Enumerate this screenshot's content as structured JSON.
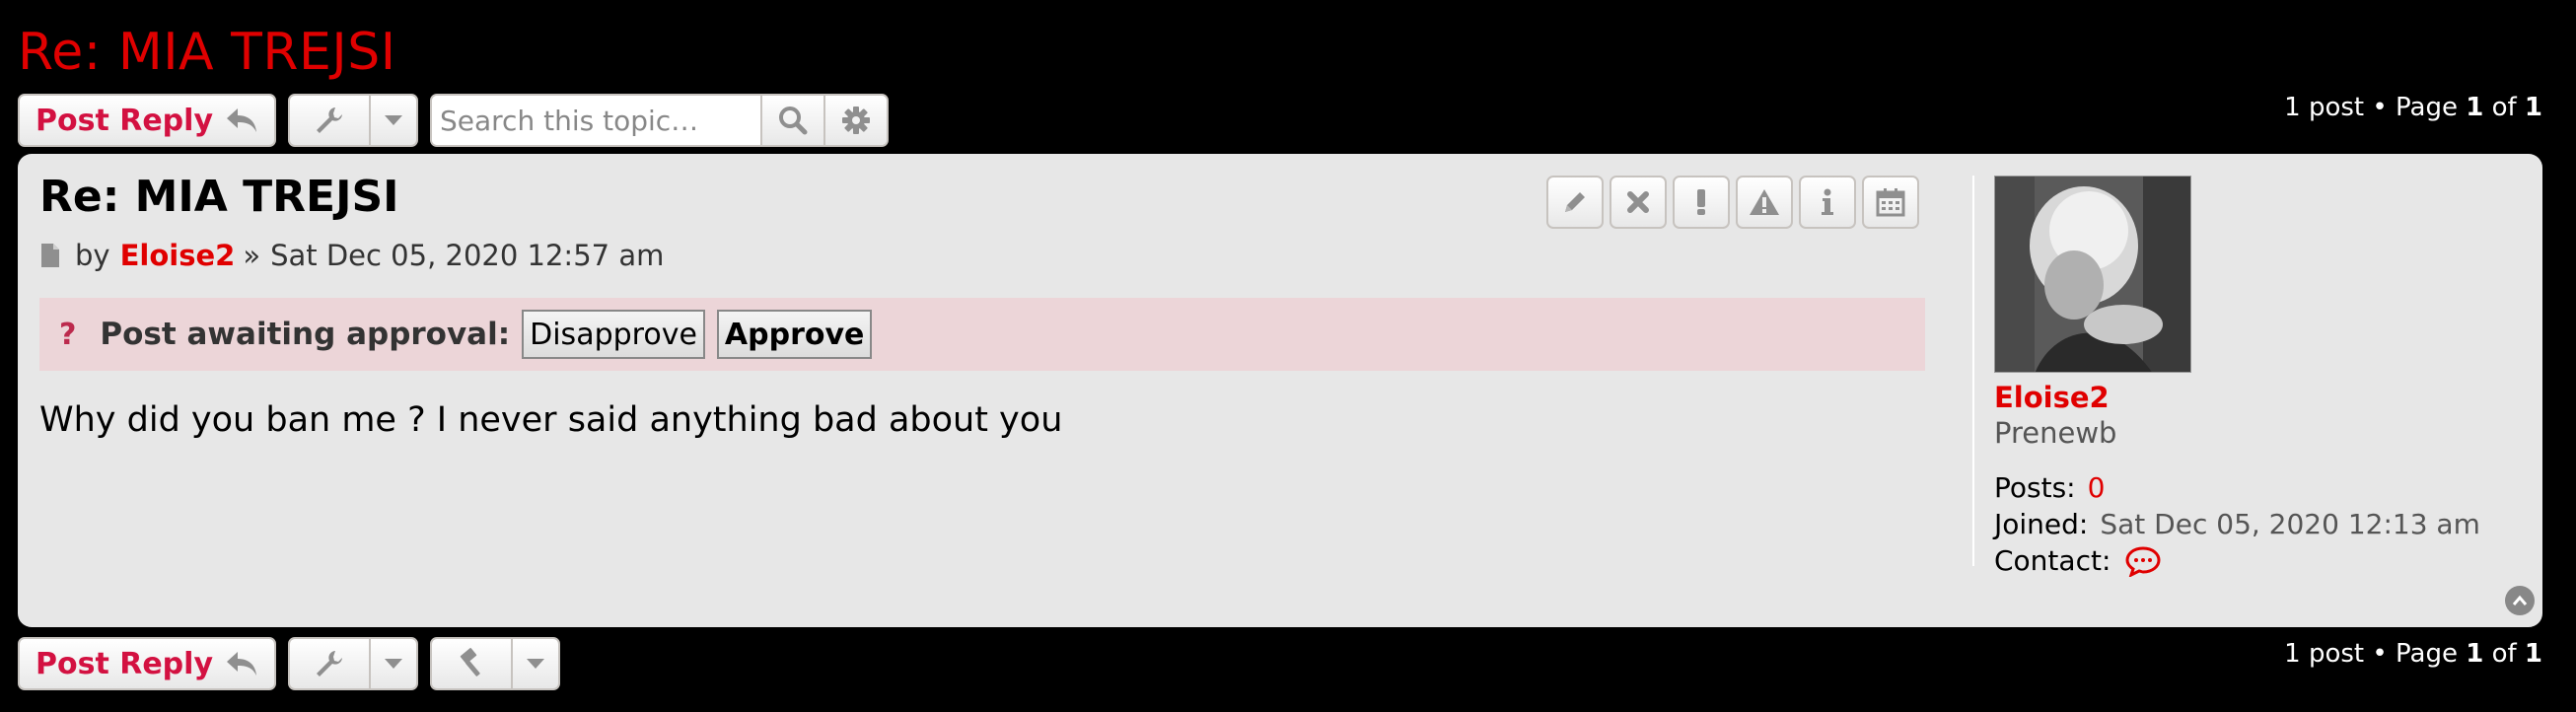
{
  "topic": {
    "title": "Re: MIA TREJSI"
  },
  "toolbar": {
    "post_reply_label": "Post Reply",
    "search_placeholder": "Search this topic…"
  },
  "pagination": {
    "prefix": "1 post • Page",
    "current": "1",
    "of": "of",
    "total": "1"
  },
  "post": {
    "title": "Re: MIA TREJSI",
    "by": "by",
    "author": "Eloise2",
    "separator": "»",
    "date": "Sat Dec 05, 2020 12:57 am",
    "approval_mark": "?",
    "approval_text": "Post awaiting approval:",
    "disapprove_label": "Disapprove",
    "approve_label": "Approve",
    "content": "Why did you ban me ? I never said anything bad about you"
  },
  "profile": {
    "username": "Eloise2",
    "rank": "Prenewb",
    "posts_label": "Posts:",
    "posts_value": "0",
    "joined_label": "Joined:",
    "joined_value": "Sat Dec 05, 2020 12:13 am",
    "contact_label": "Contact:"
  },
  "colors": {
    "brand_red": "#e00000",
    "reply_red": "#d31141",
    "panel_bg": "#e7e7e7",
    "approval_bg": "#ecd5d8"
  },
  "icons": [
    "reply-arrow-icon",
    "wrench-icon",
    "search-icon",
    "gear-icon",
    "hammer-icon",
    "pencil-icon",
    "delete-icon",
    "exclamation-icon",
    "warning-icon",
    "info-icon",
    "calendar-icon",
    "document-icon",
    "chat-icon",
    "chevron-up-icon"
  ]
}
